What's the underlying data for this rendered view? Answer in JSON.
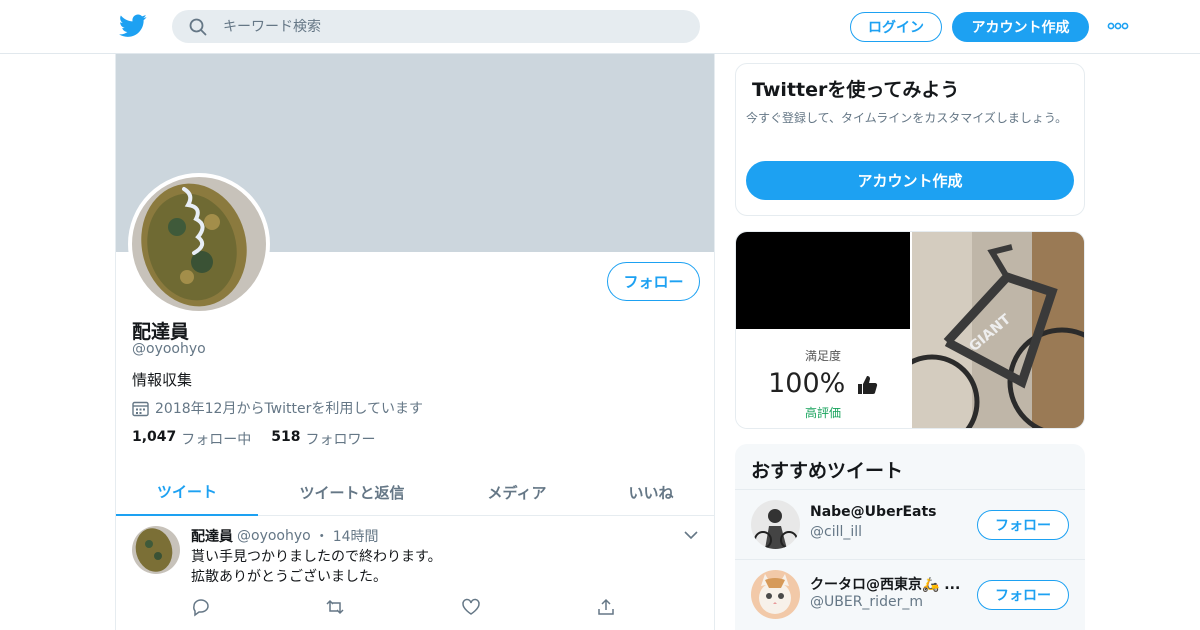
{
  "header": {
    "search_placeholder": "キーワード検索",
    "login_label": "ログイン",
    "signup_label": "アカウント作成",
    "accent_color": "#1da1f2"
  },
  "profile": {
    "name": "配達員",
    "handle": "@oyoohyo",
    "bio": "情報収集",
    "joined": "2018年12月からTwitterを利用しています",
    "following_count": "1,047",
    "following_label": "フォロー中",
    "followers_count": "518",
    "followers_label": "フォロワー",
    "follow_label": "フォロー"
  },
  "tabs": [
    {
      "label": "ツイート",
      "active": true
    },
    {
      "label": "ツイートと返信",
      "active": false
    },
    {
      "label": "メディア",
      "active": false
    },
    {
      "label": "いいね",
      "active": false
    }
  ],
  "tweet": {
    "name": "配達員",
    "handle": "@oyoohyo",
    "separator": "・",
    "time": "14時間",
    "line1": "貰い手見つかりましたので終わります。",
    "line2": "拡散ありがとうございました。"
  },
  "signup_card": {
    "title": "Twitterを使ってみよう",
    "description": "今すぐ登録して、タイムラインをカスタマイズしましょう。",
    "button_label": "アカウント作成"
  },
  "media_card": {
    "label": "満足度",
    "value": "100%",
    "sub_label": "高評価"
  },
  "recommended": {
    "title": "おすすめツイート",
    "items": [
      {
        "name": "Nabe@UberEats",
        "handle": "@cill_ill",
        "follow_label": "フォロー"
      },
      {
        "name": "クータロ@西東京🛵 ...",
        "handle": "@UBER_rider_m",
        "follow_label": "フォロー"
      }
    ]
  }
}
